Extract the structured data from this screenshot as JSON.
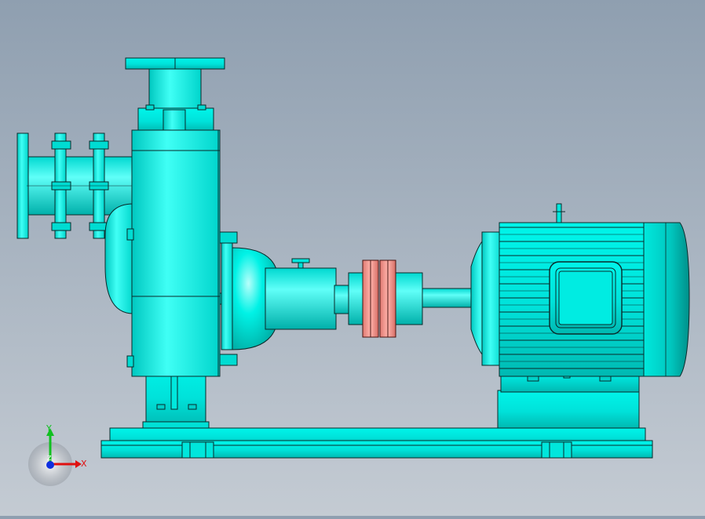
{
  "viewport": {
    "background_top": "#8f9fb0",
    "background_bottom": "#c4cbd3"
  },
  "model": {
    "body_color": "#00f2e6",
    "shade_color": "#00c8c0",
    "coupling_color": "#f29a92",
    "edge_color": "#0a2a2a"
  },
  "triad": {
    "x_label": "X",
    "y_label": "Y",
    "z_label": "Z",
    "x_color": "#e01010",
    "y_color": "#10c020",
    "z_color": "#1030e0"
  }
}
